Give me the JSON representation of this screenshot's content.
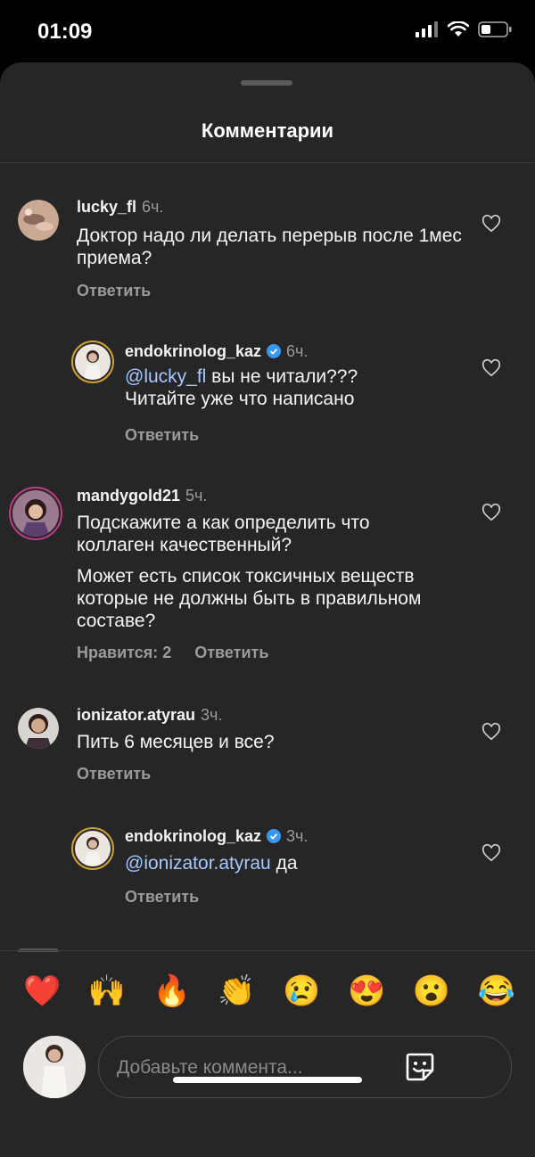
{
  "status_bar": {
    "time": "01:09"
  },
  "sheet": {
    "title": "Комментарии"
  },
  "comments": [
    {
      "username": "lucky_fl",
      "time": "6ч.",
      "text": "Доктор надо ли делать перерыв после 1мес приема?",
      "reply_label": "Ответить"
    },
    {
      "username": "endokrinolog_kaz",
      "time": "6ч.",
      "mention": "@lucky_fl",
      "text": " вы не читали??? Читайте уже что написано",
      "reply_label": "Ответить"
    },
    {
      "username": "mandygold21",
      "time": "5ч.",
      "text": "Подскажите а как определить что коллаген качественный?",
      "text2": "Может есть список токсичных веществ которые не должны быть в правильном составе?",
      "likes_label": "Нравится: 2",
      "reply_label": "Ответить"
    },
    {
      "username": "ionizator.atyrau",
      "time": "3ч.",
      "text": "Пить 6 месяцев и все?",
      "reply_label": "Ответить"
    },
    {
      "username": "endokrinolog_kaz",
      "time": "3ч.",
      "mention": "@ionizator.atyrau",
      "text": " да",
      "reply_label": "Ответить"
    }
  ],
  "emojis": [
    "❤️",
    "🙌",
    "🔥",
    "👏",
    "😢",
    "😍",
    "😮",
    "😂"
  ],
  "compose": {
    "placeholder": "Добавьте коммента..."
  },
  "icons": {
    "heart": "heart-outline-icon",
    "sticker": "sticker-icon",
    "verified": "verified-badge-icon"
  },
  "colors": {
    "background": "#262626",
    "mention": "#a5c8ff",
    "verified": "#3897f0"
  }
}
